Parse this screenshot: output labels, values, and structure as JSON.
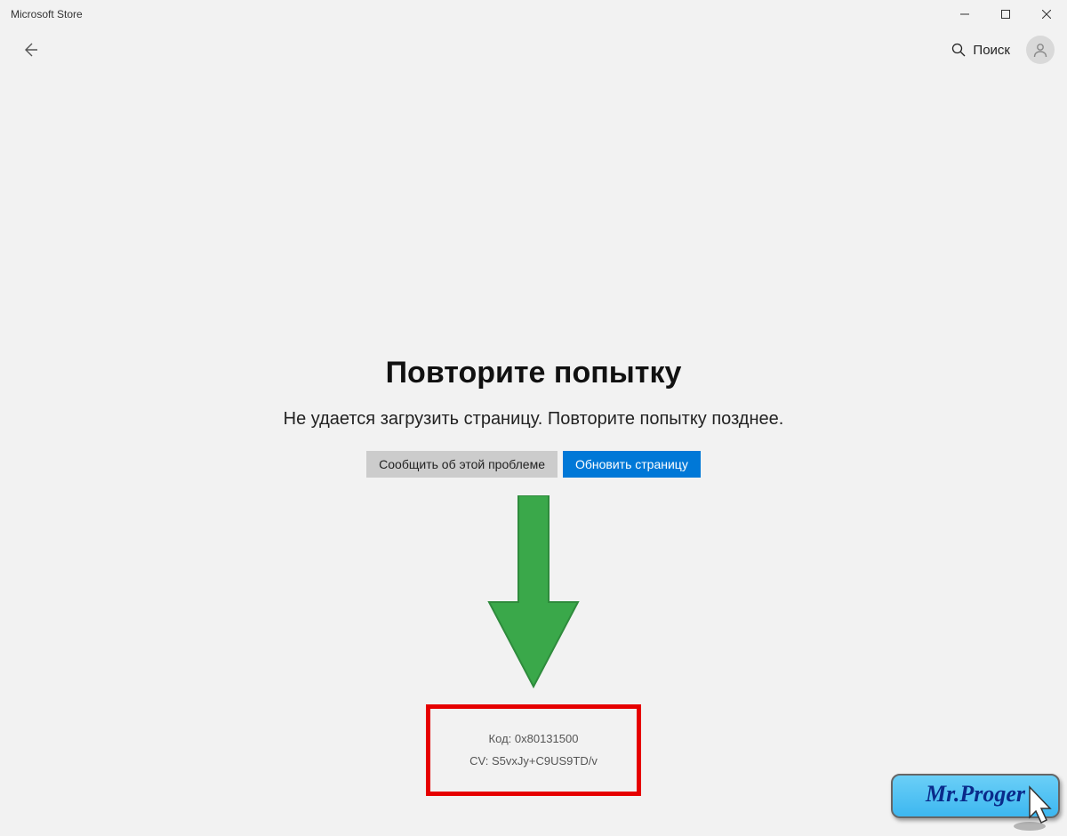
{
  "titlebar": {
    "title": "Microsoft Store"
  },
  "toolbar": {
    "search_label": "Поиск"
  },
  "error": {
    "heading": "Повторите попытку",
    "message": "Не удается загрузить страницу. Повторите попытку позднее.",
    "report_label": "Сообщить об этой проблеме",
    "refresh_label": "Обновить страницу",
    "code_line": "Код: 0x80131500",
    "cv_line": "CV: S5vxJy+C9US9TD/v"
  },
  "watermark": {
    "text": "Mr.Proger"
  },
  "annotation": {
    "arrow_color": "#3aa84a",
    "highlight_border": "#e60000"
  }
}
